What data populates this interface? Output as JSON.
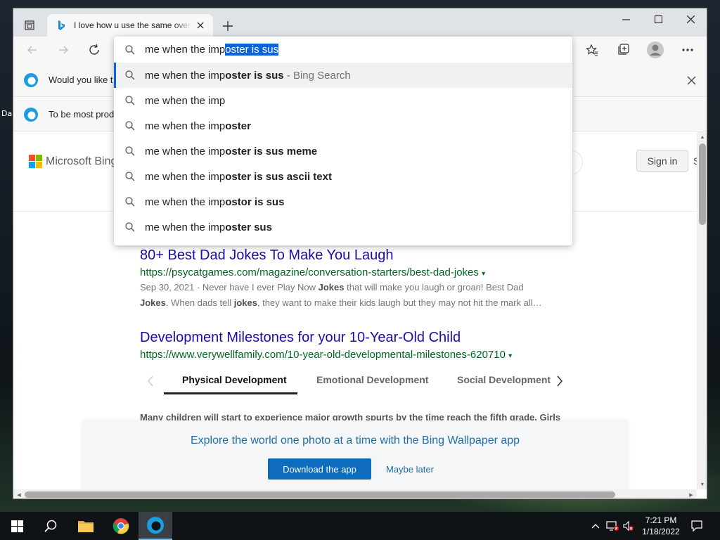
{
  "desktop": {
    "icon_label_1": "Da"
  },
  "browser": {
    "tab": {
      "title": "I love how u use the same over and over",
      "favicon": "bing-favicon"
    },
    "omnibox": {
      "typed": "me when the imp",
      "autocomplete": "oster is sus"
    },
    "suggestions": [
      {
        "prefix": "me when the imp",
        "bold": "oster is sus",
        "suffix": " - Bing Search"
      },
      {
        "prefix": "me when the imp",
        "bold": "",
        "suffix": ""
      },
      {
        "prefix": "me when the imp",
        "bold": "oster",
        "suffix": ""
      },
      {
        "prefix": "me when the imp",
        "bold": "oster is sus meme",
        "suffix": ""
      },
      {
        "prefix": "me when the imp",
        "bold": "oster is sus ascii text",
        "suffix": ""
      },
      {
        "prefix": "me when the imp",
        "bold": "ostor is sus",
        "suffix": ""
      },
      {
        "prefix": "me when the imp",
        "bold": "oster sus",
        "suffix": ""
      }
    ],
    "infobars": [
      {
        "text": "Would you like t"
      },
      {
        "text": "To be most prod"
      }
    ]
  },
  "page": {
    "logo_text": "Microsoft Bing",
    "sign_in": "Sign in",
    "sign_in_edge": "S",
    "results": [
      {
        "title": "80+ Best Dad Jokes To Make You Laugh",
        "url": "https://psycatgames.com/magazine/conversation-starters/best-dad-jokes",
        "snippet_date": "Sep 30, 2021 · Never have I ever Play Now ",
        "snippet_b1": "Jokes",
        "snippet_mid": " that will make you laugh or groan! Best Dad",
        "snippet_b2": "Jokes",
        "snippet_mid2": ". When dads tell ",
        "snippet_b3": "jokes",
        "snippet_end": ", they want to make their kids laugh but they may not hit the mark all…"
      },
      {
        "title": "Development Milestones for your 10-Year-Old Child",
        "url": "https://www.verywellfamily.com/10-year-old-developmental-milestones-620710"
      }
    ],
    "subtabs": [
      "Physical Development",
      "Emotional Development",
      "Social Development"
    ],
    "cut_text": "Many children will start to experience major growth spurts by the time reach the fifth grade. Girls",
    "promo": {
      "text": "Explore the world one photo at a time with the Bing Wallpaper app",
      "button": "Download the app",
      "later": "Maybe later"
    }
  },
  "taskbar": {
    "time": "7:21 PM",
    "date": "1/18/2022",
    "apps": [
      "start-icon",
      "search-icon",
      "file-explorer-icon",
      "chrome-icon",
      "edge-icon"
    ]
  },
  "colors": {
    "link": "#1a0dab",
    "url": "#006621",
    "accent": "#0a64d8"
  }
}
